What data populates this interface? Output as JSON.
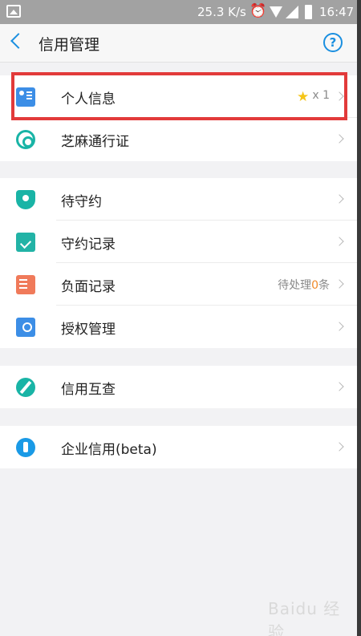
{
  "status_bar": {
    "speed": "25.3 K/s",
    "time": "16:47"
  },
  "nav": {
    "title": "信用管理",
    "help_glyph": "?"
  },
  "groups": [
    {
      "items": [
        {
          "label": "个人信息",
          "icon": "id-card-icon",
          "extra": "x 1"
        },
        {
          "label": "芝麻通行证",
          "icon": "sesame-pass-icon"
        }
      ]
    },
    {
      "items": [
        {
          "label": "待守约",
          "icon": "shield-user-icon"
        },
        {
          "label": "守约记录",
          "icon": "calendar-check-icon"
        },
        {
          "label": "负面记录",
          "icon": "document-x-icon",
          "extra_prefix": "待处理",
          "extra_count": "0",
          "extra_suffix": "条"
        },
        {
          "label": "授权管理",
          "icon": "folder-settings-icon"
        }
      ]
    },
    {
      "items": [
        {
          "label": "信用互查",
          "icon": "mutual-check-icon"
        }
      ]
    },
    {
      "items": [
        {
          "label": "企业信用(beta)",
          "icon": "enterprise-credit-icon"
        }
      ]
    }
  ],
  "colors": {
    "accent": "#1a8fe0",
    "highlight": "#e23a3a",
    "star": "#f5c518",
    "count": "#f08a2a"
  },
  "watermark": "Baidu 经验"
}
